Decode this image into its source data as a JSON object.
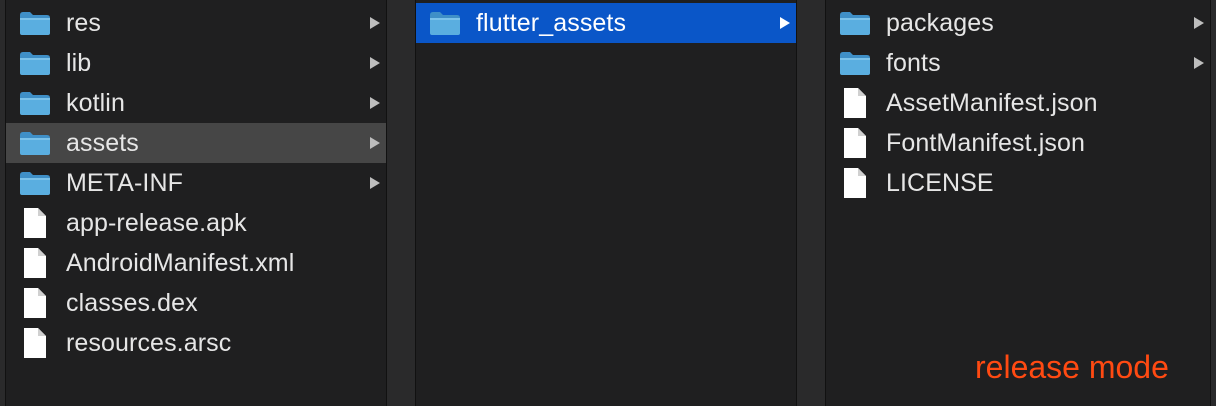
{
  "columns": [
    {
      "items": [
        {
          "label": "res",
          "type": "folder",
          "icon": "folder-icon",
          "has_children": true,
          "state": "normal"
        },
        {
          "label": "lib",
          "type": "folder",
          "icon": "folder-icon",
          "has_children": true,
          "state": "normal"
        },
        {
          "label": "kotlin",
          "type": "folder",
          "icon": "folder-icon",
          "has_children": true,
          "state": "normal"
        },
        {
          "label": "assets",
          "type": "folder",
          "icon": "folder-icon",
          "has_children": true,
          "state": "selected-inactive"
        },
        {
          "label": "META-INF",
          "type": "folder",
          "icon": "folder-icon",
          "has_children": true,
          "state": "normal"
        },
        {
          "label": "app-release.apk",
          "type": "file",
          "icon": "file-icon",
          "has_children": false,
          "state": "normal"
        },
        {
          "label": "AndroidManifest.xml",
          "type": "file",
          "icon": "file-icon",
          "has_children": false,
          "state": "normal"
        },
        {
          "label": "classes.dex",
          "type": "file",
          "icon": "file-icon",
          "has_children": false,
          "state": "normal"
        },
        {
          "label": "resources.arsc",
          "type": "file",
          "icon": "file-icon",
          "has_children": false,
          "state": "normal"
        }
      ]
    },
    {
      "items": [
        {
          "label": "flutter_assets",
          "type": "folder",
          "icon": "folder-icon",
          "has_children": true,
          "state": "selected-active"
        }
      ]
    },
    {
      "items": [
        {
          "label": "packages",
          "type": "folder",
          "icon": "folder-icon",
          "has_children": true,
          "state": "normal"
        },
        {
          "label": "fonts",
          "type": "folder",
          "icon": "folder-icon",
          "has_children": true,
          "state": "normal"
        },
        {
          "label": "AssetManifest.json",
          "type": "file",
          "icon": "file-icon",
          "has_children": false,
          "state": "normal"
        },
        {
          "label": "FontManifest.json",
          "type": "file",
          "icon": "file-icon",
          "has_children": false,
          "state": "normal"
        },
        {
          "label": "LICENSE",
          "type": "file",
          "icon": "file-icon",
          "has_children": false,
          "state": "normal"
        }
      ]
    }
  ],
  "annotation": {
    "label": "release mode",
    "color": "#ff4a12"
  },
  "colors": {
    "background": "#1f1f20",
    "selection_active": "#0a56c8",
    "selection_inactive": "#464646",
    "folder": "#5aaee0",
    "text": "#e6e6e6"
  }
}
